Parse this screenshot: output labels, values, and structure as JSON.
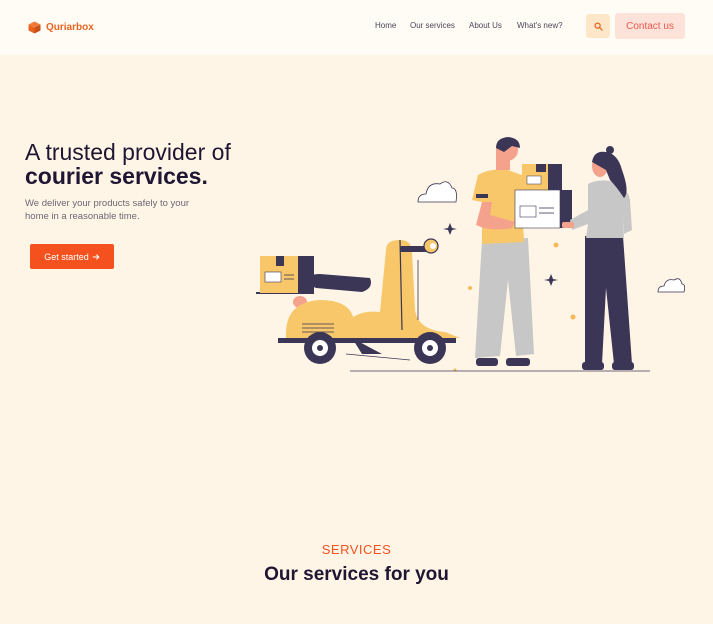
{
  "brand": {
    "name": "Quriarbox",
    "logo_icon": "box-icon",
    "accent": "#f4511e"
  },
  "nav": {
    "links": [
      "Home",
      "Our services",
      "About Us",
      "What's new?"
    ],
    "search_icon": "search-icon",
    "contact_label": "Contact us"
  },
  "hero": {
    "title_line1": "A trusted provider of",
    "title_line2": "courier services.",
    "description": "We deliver your products safely to your home in a reasonable time.",
    "cta_label": "Get started",
    "cta_icon": "arrow-right-icon"
  },
  "services": {
    "eyebrow": "SERVICES",
    "title": "Our services for you"
  }
}
